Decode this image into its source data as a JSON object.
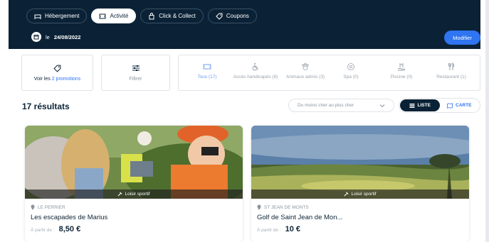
{
  "tabs": [
    {
      "label": "Hébergement",
      "icon": "bed-icon",
      "active": false
    },
    {
      "label": "Activité",
      "icon": "ticket-icon",
      "active": true
    },
    {
      "label": "Click & Collect",
      "icon": "bag-icon",
      "active": false
    },
    {
      "label": "Coupons",
      "icon": "tag-icon",
      "active": false
    }
  ],
  "date": {
    "prefix": "le",
    "value": "24/08/2022"
  },
  "modifier_label": "Modifier",
  "promo": {
    "prefix": "Voir les",
    "highlight": "2 promotions"
  },
  "filter_label": "Filtrer",
  "categories": [
    {
      "label": "Tous (17)",
      "icon": "ticket-icon",
      "active": true
    },
    {
      "label": "Accès handicapés (8)",
      "icon": "wheelchair-icon",
      "active": false
    },
    {
      "label": "Animaux admis (3)",
      "icon": "paw-icon",
      "active": false
    },
    {
      "label": "Spa (0)",
      "icon": "lotus-icon",
      "active": false
    },
    {
      "label": "Piscine (0)",
      "icon": "pool-icon",
      "active": false
    },
    {
      "label": "Restaurant (1)",
      "icon": "cutlery-icon",
      "active": false
    }
  ],
  "results_label": "17 résultats",
  "sort_label": "Du moins cher au plus cher",
  "view_toggle": {
    "list": "LISTE",
    "map": "CARTE",
    "active": "list"
  },
  "cards": [
    {
      "tag": "Loisir sportif",
      "location": "LE PERRIER",
      "title": "Les escapades de Marius",
      "price_label": "À partir de :",
      "price": "8,50 €"
    },
    {
      "tag": "Loisir sportif",
      "location": "ST JEAN DE MONTS",
      "title": "Golf de Saint Jean de Mon...",
      "price_label": "À partir de :",
      "price": "10 €"
    }
  ],
  "colors": {
    "navy": "#0b2236",
    "accent": "#2f74f0",
    "muted": "#8a96a1"
  }
}
